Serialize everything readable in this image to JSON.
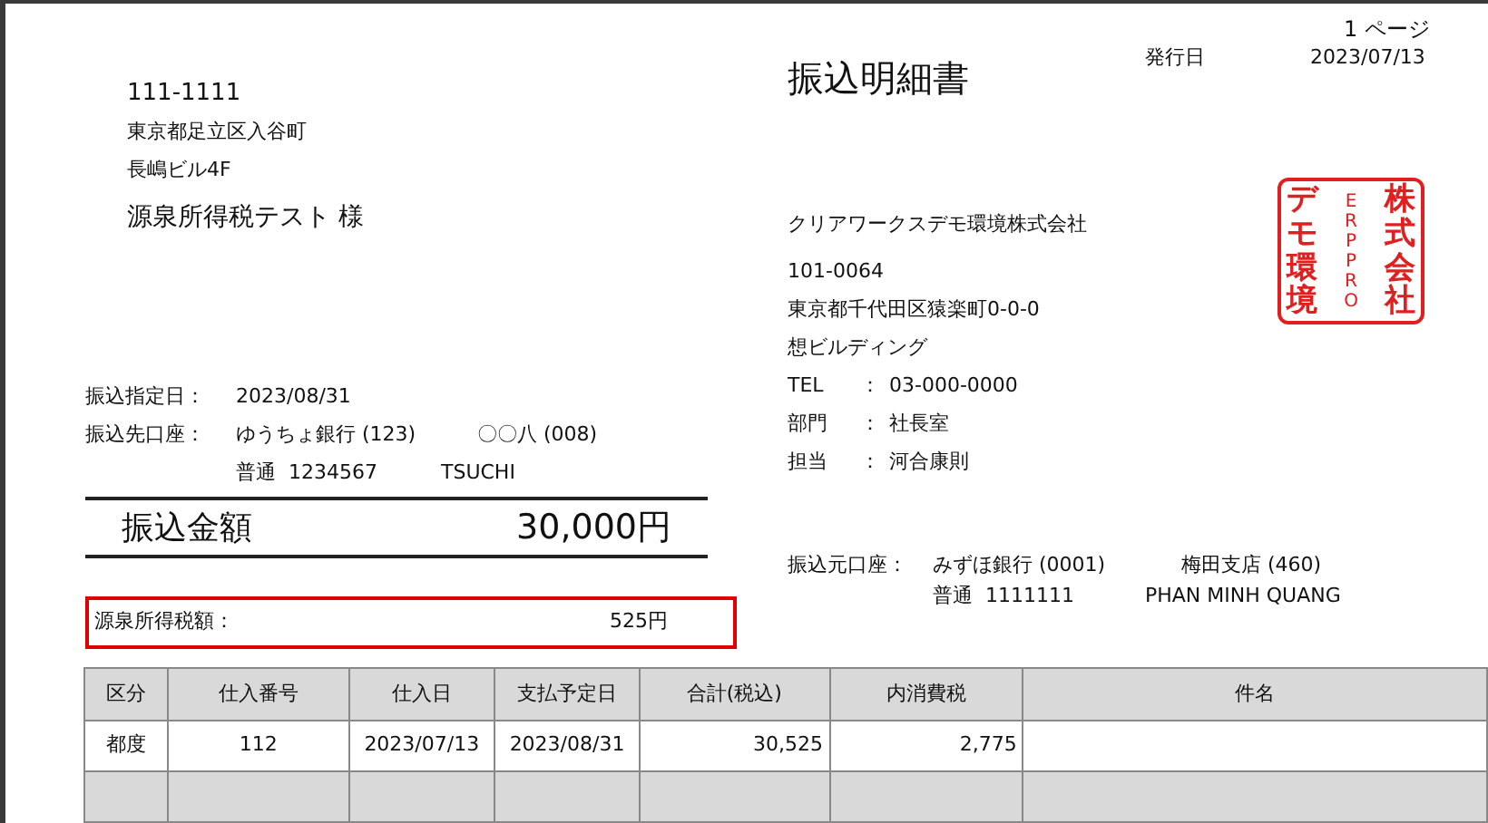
{
  "page": {
    "page_number": "1 ページ"
  },
  "recipient": {
    "postal": "111-1111",
    "address_lines": [
      "東京都足立区入谷町",
      "長嶋ビル4F"
    ],
    "name": "源泉所得税テスト 様"
  },
  "transfer": {
    "date_label": "振込指定日：",
    "date": "2023/08/31",
    "account_label": "振込先口座：",
    "bank": "ゆうちょ銀行 (123)",
    "branch": "〇〇八 (008)",
    "account": "普通  1234567",
    "holder": "TSUCHI"
  },
  "amount": {
    "label": "振込金額",
    "value": "30,000円"
  },
  "withholding": {
    "label": "源泉所得税額：",
    "value": "525円"
  },
  "title": "振込明細書",
  "issue": {
    "label": "発行日",
    "date": "2023/07/13"
  },
  "issuer": {
    "company": "クリアワークスデモ環境株式会社",
    "postal": "101-0064",
    "address": "東京都千代田区猿楽町0-0-0",
    "building": "想ビルディング",
    "contacts": [
      {
        "label": "TEL",
        "separator": "：",
        "value": "03-000-0000"
      },
      {
        "label": "部門",
        "separator": "：",
        "value": "社長室"
      },
      {
        "label": "担当",
        "separator": "：",
        "value": "河合康則"
      }
    ]
  },
  "stamp": {
    "columns": [
      "デモ環境",
      "ERPPRO",
      "株式会社"
    ]
  },
  "source_account": {
    "label": "振込元口座：",
    "bank": "みずほ銀行 (0001)",
    "branch": "梅田支店 (460)",
    "account": "普通  1111111",
    "holder": "PHAN MINH QUANG"
  },
  "table": {
    "columns": [
      "区分",
      "仕入番号",
      "仕入日",
      "支払予定日",
      "合計(税込)",
      "内消費税",
      "件名"
    ],
    "rows": [
      {
        "cells": [
          "都度",
          "112",
          "2023/07/13",
          "2023/08/31",
          "30,525",
          "2,775"
        ]
      }
    ]
  }
}
